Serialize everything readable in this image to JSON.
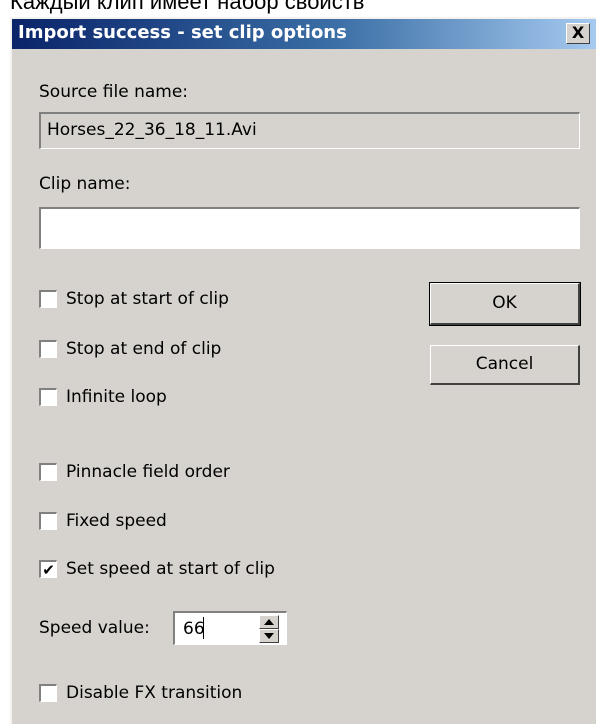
{
  "background_caption": "Каждый клип имеет набор свойств",
  "dialog": {
    "title": "Import success - set clip options",
    "close_glyph": "X"
  },
  "source_file": {
    "label": "Source file name:",
    "value": "Horses_22_36_18_11.Avi"
  },
  "clip_name": {
    "label": "Clip name:",
    "value": ""
  },
  "options": [
    {
      "label": "Stop at start of clip",
      "checked": false
    },
    {
      "label": "Stop at end of clip",
      "checked": false
    },
    {
      "label": "Infinite loop",
      "checked": false
    },
    {
      "label": "Pinnacle field order",
      "checked": false
    },
    {
      "label": "Fixed speed",
      "checked": false
    },
    {
      "label": "Set speed at start of clip",
      "checked": true
    }
  ],
  "speed": {
    "label": "Speed value:",
    "value": "66"
  },
  "disable_fx": {
    "label": "Disable FX transition",
    "checked": false
  },
  "buttons": {
    "ok": "OK",
    "cancel": "Cancel"
  },
  "check_glyph": "✔",
  "colors": {
    "dialog_bg": "#d6d3ce",
    "title_start": "#0a246a",
    "title_end": "#a6caf0"
  }
}
